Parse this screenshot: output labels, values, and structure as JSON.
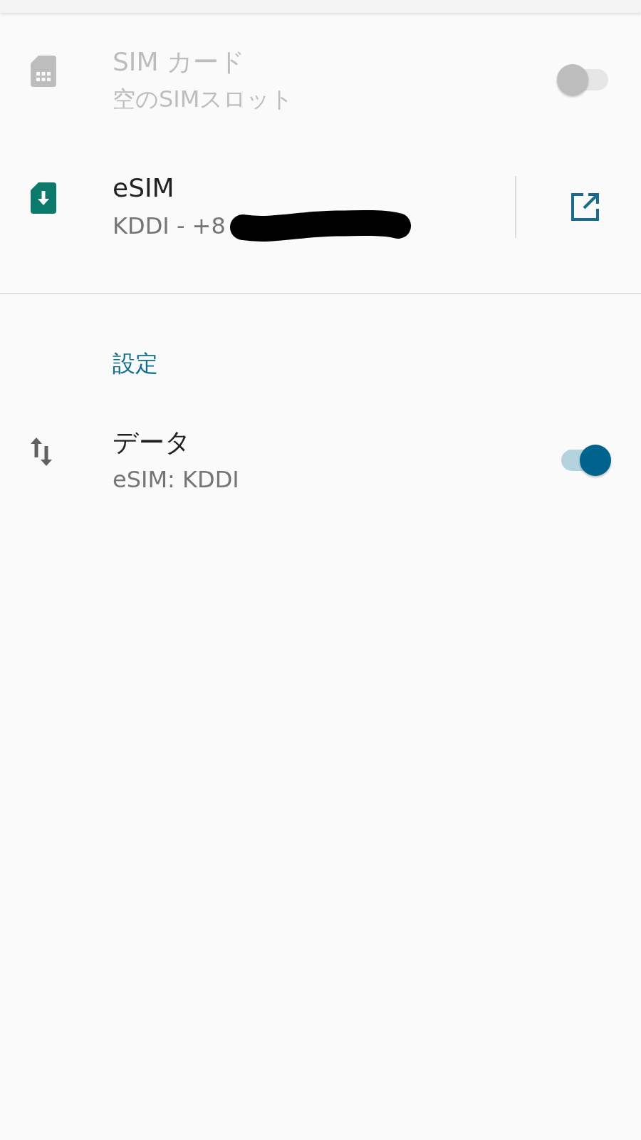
{
  "sim_list": [
    {
      "kind": "physical",
      "title": "SIM カード",
      "subtitle": "空のSIMスロット",
      "disabled": true,
      "on": false
    },
    {
      "kind": "esim",
      "title": "eSIM",
      "subtitle": "KDDI - +8",
      "disabled": false,
      "redacted": true
    }
  ],
  "settings": {
    "header": "設定",
    "items": [
      {
        "kind": "data",
        "title": "データ",
        "subtitle": "eSIM: KDDI",
        "disabled": false,
        "on": true
      }
    ]
  }
}
